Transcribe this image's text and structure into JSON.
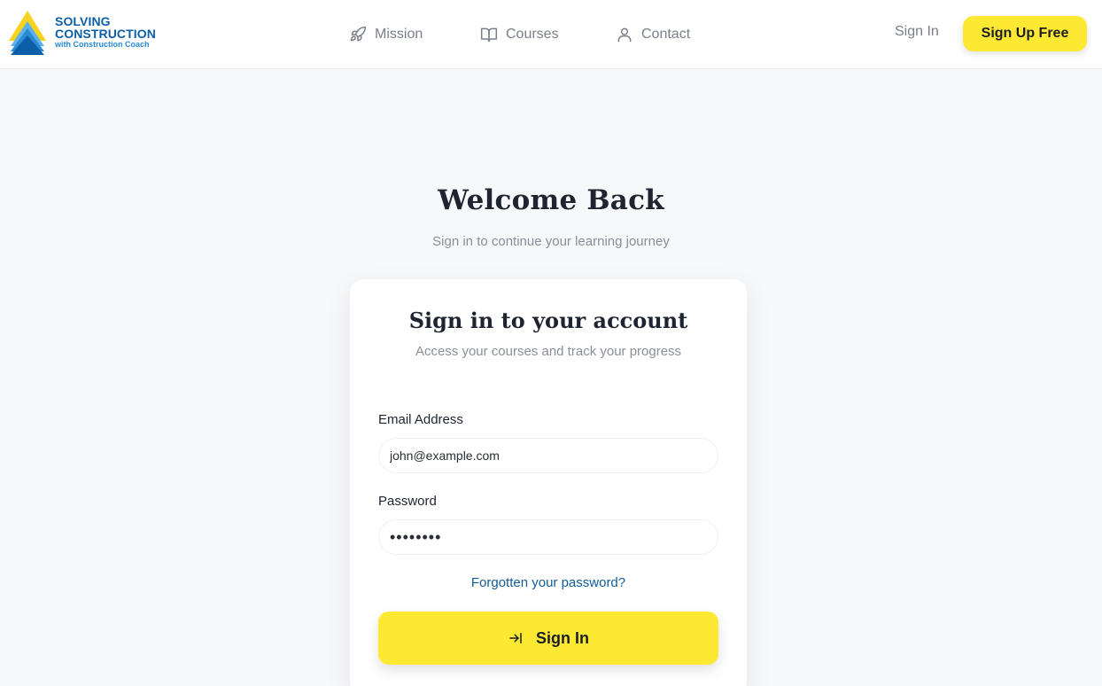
{
  "brand": {
    "title_line1": "SOLVING",
    "title_line2": "CONSTRUCTION",
    "subtitle": "with Construction Coach",
    "logo_icon": "triangle-logo-icon",
    "colors": {
      "blue": "#0c5fa6",
      "light_blue": "#2a8ad6",
      "yellow": "#f7d21e"
    }
  },
  "nav": {
    "items": [
      {
        "label": "Mission",
        "icon": "rocket-icon"
      },
      {
        "label": "Courses",
        "icon": "open-book-icon"
      },
      {
        "label": "Contact",
        "icon": "user-icon"
      }
    ],
    "signin_label": "Sign In",
    "signup_label": "Sign Up Free"
  },
  "page": {
    "title": "Welcome Back",
    "subtitle": "Sign in to continue your learning journey"
  },
  "card": {
    "title": "Sign in to your account",
    "subtitle": "Access your courses and track your progress",
    "email": {
      "label": "Email Address",
      "value": "john@example.com"
    },
    "password": {
      "label": "Password",
      "value": "••••••••"
    },
    "forgot_label": "Forgotten your password?",
    "submit_label": "Sign In",
    "submit_icon": "login-arrow-icon"
  },
  "colors": {
    "accent": "#fde932",
    "link": "#135c98",
    "background": "#f7f8fa",
    "muted_text": "#8a8e96"
  }
}
